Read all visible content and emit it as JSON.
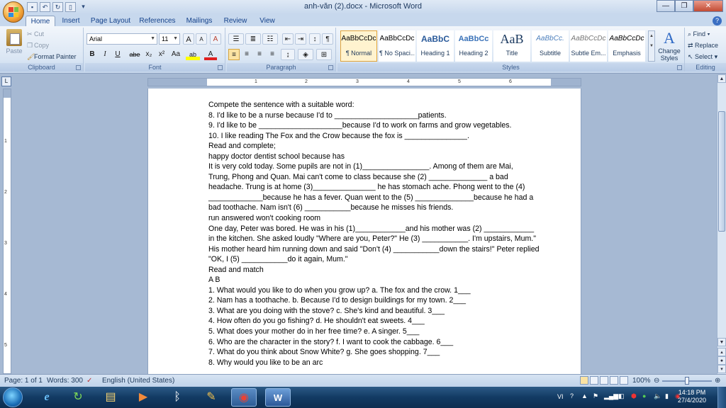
{
  "window": {
    "title": "anh-văn (2).docx - Microsoft Word",
    "minimize": "—",
    "maximize": "❐",
    "close": "✕"
  },
  "tabs": [
    "Home",
    "Insert",
    "Page Layout",
    "References",
    "Mailings",
    "Review",
    "View"
  ],
  "clipboard": {
    "paste": "Paste",
    "cut": "Cut",
    "copy": "Copy",
    "format_painter": "Format Painter",
    "label": "Clipboard"
  },
  "font": {
    "name": "Arial",
    "size": "11",
    "label": "Font",
    "bold": "B",
    "italic": "I",
    "underline": "U",
    "strike": "abe",
    "subscript": "x₂",
    "superscript": "x²",
    "change_case": "Aa",
    "grow": "A",
    "shrink": "A",
    "clear": "A",
    "highlight": "ab",
    "color": "A"
  },
  "paragraph": {
    "label": "Paragraph",
    "show_marks": "¶"
  },
  "styles": {
    "label": "Styles",
    "items": [
      {
        "preview": "AaBbCcDc",
        "name": "¶ Normal"
      },
      {
        "preview": "AaBbCcDc",
        "name": "¶ No Spaci..."
      },
      {
        "preview": "AaBbC",
        "name": "Heading 1"
      },
      {
        "preview": "AaBbCc",
        "name": "Heading 2"
      },
      {
        "preview": "AaB",
        "name": "Title"
      },
      {
        "preview": "AaBbCc.",
        "name": "Subtitle"
      },
      {
        "preview": "AaBbCcDc",
        "name": "Subtle Em..."
      },
      {
        "preview": "AaBbCcDc",
        "name": "Emphasis"
      }
    ],
    "change_styles": "Change Styles"
  },
  "editing": {
    "label": "Editing",
    "find": "Find",
    "replace": "Replace",
    "select": "Select"
  },
  "document": {
    "lines": [
      "Compete the sentence with a suitable word:",
      "8. I'd like to be a nurse because I'd to ____________________patients.",
      "9. I'd like to be ____________________because  I'd to work on farms and grow vegetables.",
      "10. I like reading The Fox and the Crow because the fox is _______________.",
      "Read and complete;",
      "happy doctor dentist school because has",
      "It is very cold today. Some pupils are not in (1)________________.  Among of them are Mai,",
      "Trung, Phong and Quan. Mai can't come to class because she (2) ______________  a bad",
      "headache. Trung is at home (3)_______________  he has stomach ache. Phong went to the (4)",
      "_____________because he has a fever. Quan went to the (5) ______________because he had a",
      "bad toothache. Nam isn't (6) ___________because  he misses his friends.",
      "run answered won't cooking room",
      "One day, Peter was bored. He was in his (1)____________and  his mother was (2) ____________",
      "in the kitchen. She asked loudly \"Where are you, Peter?\" He (3) ___________.  I'm upstairs,  Mum.\"",
      "His mother heard him running down and said \"Don't (4) ___________down the stairs!\" Peter replied",
      "\"OK, I (5) ___________do  it again, Mum.\"",
      "Read and match",
      "A B",
      "1. What would you like to do when you grow up? a. The fox and the crow. 1___",
      "2. Nam has a toothache. b. Because I'd to design buildings  for my town. 2___",
      "3. What are you doing with the stove? c. She's kind and beautiful. 3___",
      "4. How often do you go fishing? d. He shouldn't eat sweets. 4___",
      "5. What does your mother do in her free time? e. A singer. 5___",
      "6. Who are the character in the story? f. I want to cook the cabbage. 6___",
      "7. What do you think about Snow White? g. She goes shopping. 7___",
      "8. Why would you like to be an arc"
    ]
  },
  "status": {
    "page": "Page: 1 of 1",
    "words": "Words: 300",
    "language": "English (United States)",
    "zoom": "100%"
  },
  "taskbar": {
    "lang": "VI",
    "time": "14:18 PM",
    "date": "27/4/2020"
  },
  "colors": {
    "ribbon_bg": "#dae6f4",
    "taskbar_bg": "#123a63",
    "selected_style": "#fff3cf"
  }
}
